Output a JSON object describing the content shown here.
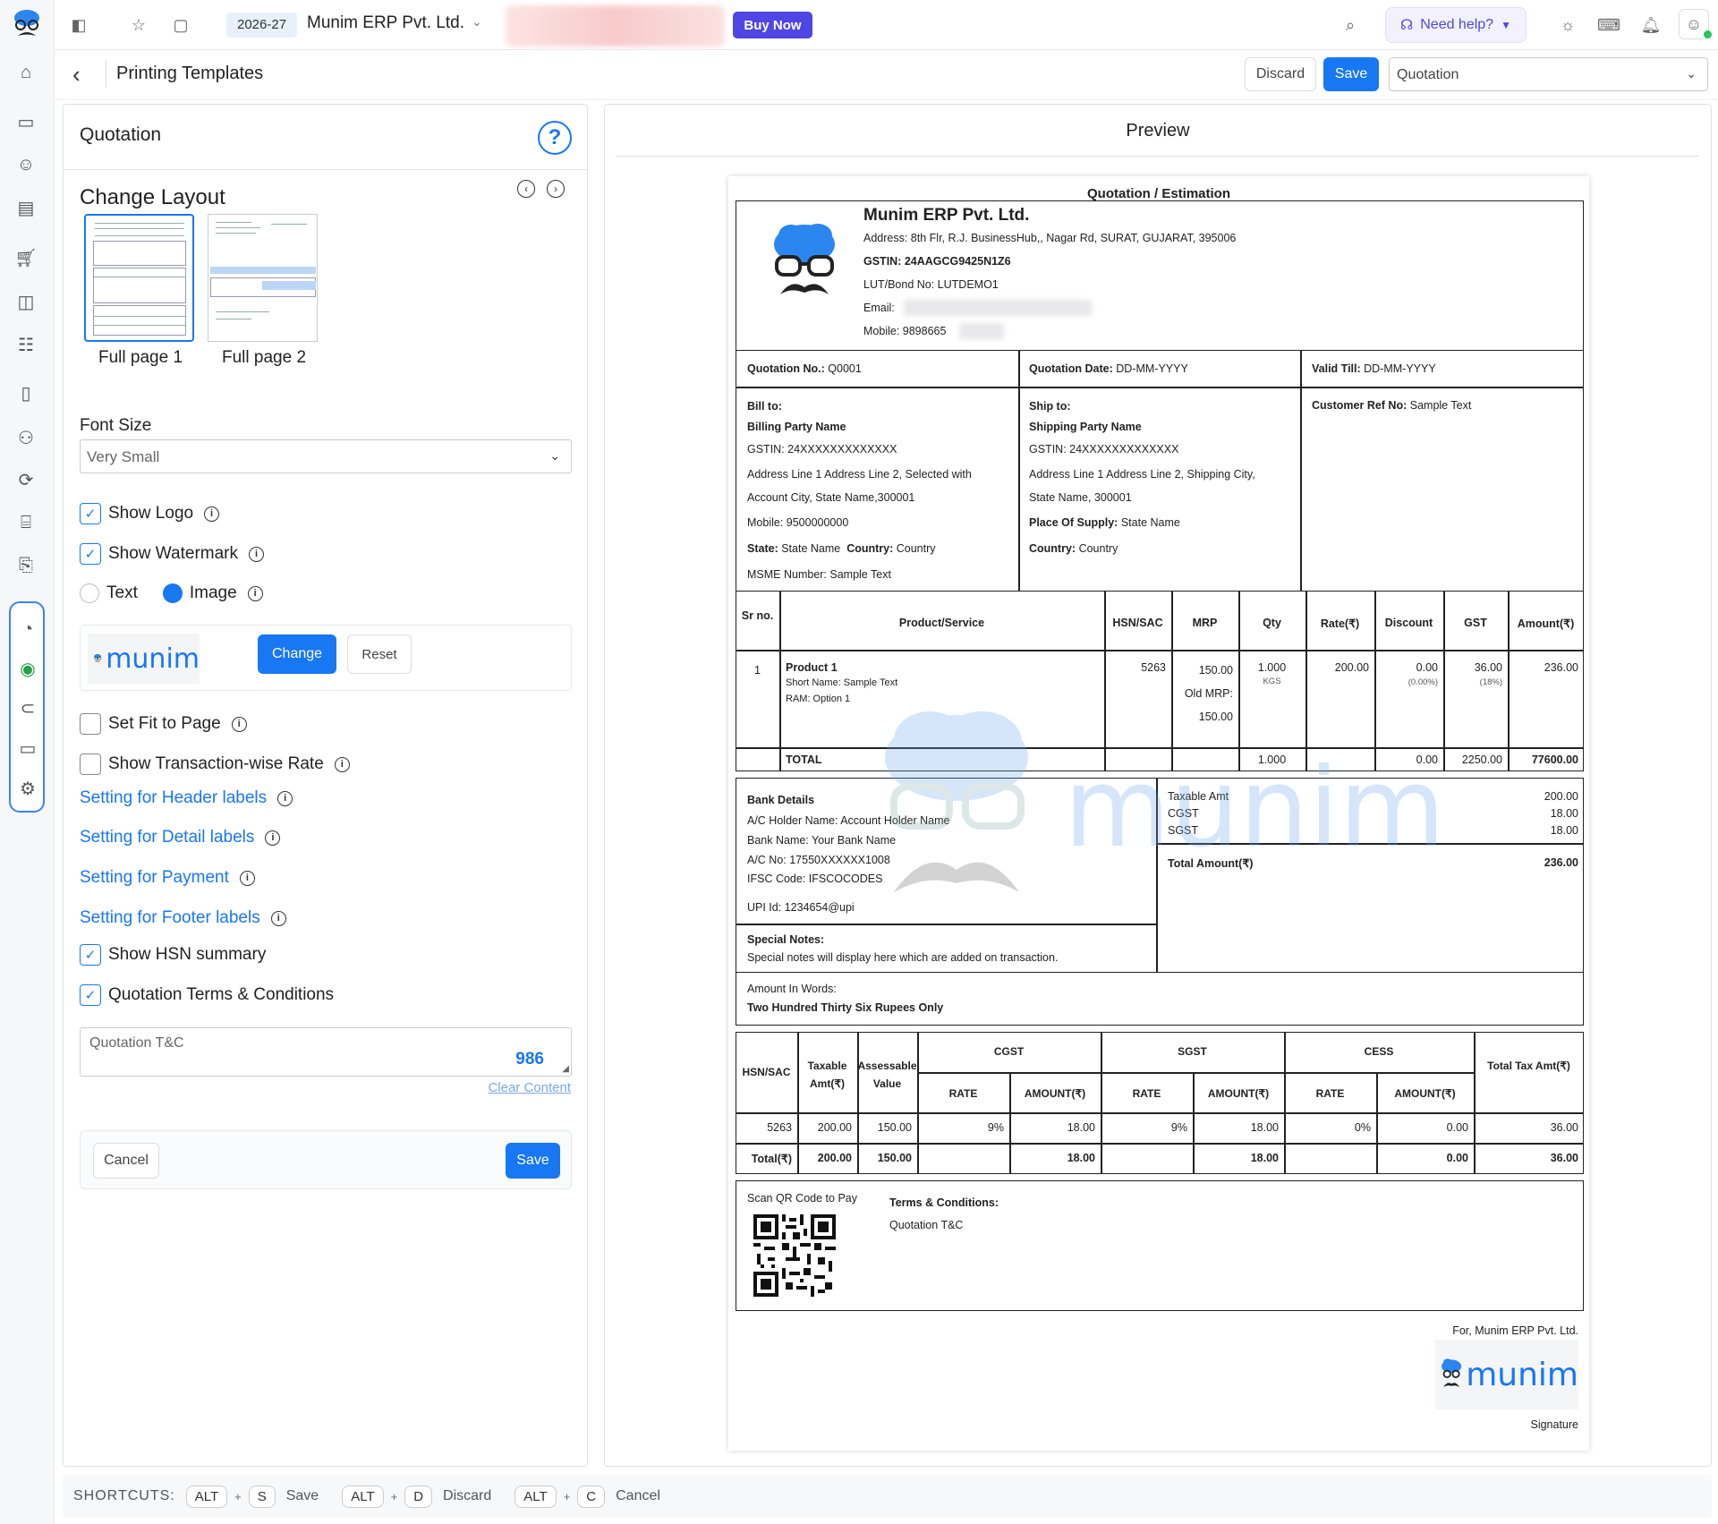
{
  "topbar": {
    "year": "2026-27",
    "company": "Munim ERP Pvt. Ltd.",
    "buy_now": "Buy Now",
    "need_help": "Need help?"
  },
  "subheader": {
    "title": "Printing Templates",
    "discard": "Discard",
    "save": "Save",
    "template_select": "Quotation"
  },
  "left": {
    "title": "Quotation",
    "help": "?",
    "change_layout": "Change Layout",
    "layouts": [
      "Full page 1",
      "Full page 2"
    ],
    "font_size_label": "Font Size",
    "font_size_value": "Very Small",
    "show_logo": "Show Logo",
    "show_watermark": "Show Watermark",
    "radio_text": "Text",
    "radio_image": "Image",
    "watermark_logo_text": "munim",
    "change": "Change",
    "reset": "Reset",
    "set_fit": "Set Fit to Page",
    "show_txn_rate": "Show Transaction-wise Rate",
    "links": [
      "Setting for Header labels",
      "Setting for Detail labels",
      "Setting for Payment",
      "Setting for Footer labels"
    ],
    "show_hsn": "Show HSN summary",
    "quotation_tc": "Quotation Terms & Conditions",
    "tc_placeholder": "Quotation  T&C",
    "tc_count": "986",
    "clear_content": "Clear Content",
    "cancel": "Cancel",
    "save": "Save"
  },
  "preview": {
    "title": "Preview",
    "doc_title": "Quotation / Estimation",
    "company": "Munim ERP Pvt. Ltd.",
    "address": "Address: 8th Flr, R.J. BusinessHub,, Nagar Rd, SURAT, GUJARAT, 395006",
    "gstin": "GSTIN: 24AAGCG9425N1Z6",
    "lut": "LUT/Bond No: LUTDEMO1",
    "email": "Email:",
    "mobile": "Mobile: 9898665",
    "quotation_no_label": "Quotation No.:",
    "quotation_no": "Q0001",
    "quotation_date_label": "Quotation Date:",
    "quotation_date": "DD-MM-YYYY",
    "valid_till_label": "Valid Till:",
    "valid_till": "DD-MM-YYYY",
    "bill_to": {
      "heading": "Bill to:",
      "name": "Billing Party Name",
      "gstin": "GSTIN: 24XXXXXXXXXXXXX",
      "addr1": "Address Line 1 Address Line 2, Selected with",
      "addr2": "Account City, State Name,300001",
      "mobile": "Mobile: 9500000000",
      "state_label": "State:",
      "state": "State Name",
      "country_label": "Country:",
      "country": "Country",
      "msme": "MSME Number: Sample Text"
    },
    "ship_to": {
      "heading": "Ship to:",
      "name": "Shipping Party Name",
      "gstin": "GSTIN: 24XXXXXXXXXXXXX",
      "addr1": "Address Line 1 Address Line 2, Shipping City,",
      "addr2": "State Name, 300001",
      "pos_label": "Place Of Supply:",
      "pos": "State Name",
      "country_label": "Country:",
      "country": "Country"
    },
    "cust_ref_label": "Customer Ref No:",
    "cust_ref": "Sample Text",
    "items_headers": [
      "Sr no.",
      "Product/Service",
      "HSN/SAC",
      "MRP",
      "Qty",
      "Rate(₹)",
      "Discount",
      "GST",
      "Amount(₹)"
    ],
    "item": {
      "sr": "1",
      "name": "Product 1",
      "short": "Short Name: Sample Text",
      "ram": "RAM: Option 1",
      "hsn": "5263",
      "mrp": "150.00",
      "old_mrp_label": "Old MRP:",
      "old_mrp": "150.00",
      "qty": "1.000",
      "unit": "KGS",
      "rate": "200.00",
      "discount": "0.00",
      "discount_pct": "(0.00%)",
      "gst": "36.00",
      "gst_pct": "(18%)",
      "amount": "236.00"
    },
    "total": {
      "label": "TOTAL",
      "qty": "1.000",
      "discount": "0.00",
      "gst": "2250.00",
      "amount": "77600.00"
    },
    "bank": {
      "heading": "Bank Details",
      "holder": "A/C Holder Name: Account Holder Name",
      "bank": "Bank Name: Your Bank Name",
      "acno": "A/C No: 17550XXXXXX1008",
      "ifsc": "IFSC Code: IFSCOCODES",
      "upi": "UPI Id: 1234654@upi"
    },
    "summary": {
      "taxable_label": "Taxable Amt",
      "taxable": "200.00",
      "cgst_label": "CGST",
      "cgst": "18.00",
      "sgst_label": "SGST",
      "sgst": "18.00",
      "total_label": "Total Amount(₹)",
      "total": "236.00"
    },
    "special_notes_label": "Special Notes:",
    "special_notes": "Special notes will display here which are added on transaction.",
    "amount_words_label": "Amount In Words:",
    "amount_words": "Two Hundred Thirty Six Rupees Only",
    "hsn_table": {
      "hsn_sac": "HSN/SAC",
      "taxable": "Taxable Amt(₹)",
      "assessable": "Assessable Value",
      "cgst": "CGST",
      "sgst": "SGST",
      "cess": "CESS",
      "rate": "RATE",
      "amount": "AMOUNT(₹)",
      "total_tax": "Total Tax Amt(₹)",
      "row": {
        "hsn": "5263",
        "taxable": "200.00",
        "assessable": "150.00",
        "cgst_rate": "9%",
        "cgst_amt": "18.00",
        "sgst_rate": "9%",
        "sgst_amt": "18.00",
        "cess_rate": "0%",
        "cess_amt": "0.00",
        "total": "36.00"
      },
      "total_row": {
        "label": "Total(₹)",
        "taxable": "200.00",
        "assessable": "150.00",
        "cgst_amt": "18.00",
        "sgst_amt": "18.00",
        "cess_amt": "0.00",
        "total": "36.00"
      }
    },
    "qr_label": "Scan QR Code to Pay",
    "terms_label": "Terms & Conditions:",
    "terms": "Quotation T&C",
    "for_company": "For, Munim ERP Pvt. Ltd.",
    "signature": "Signature",
    "sign_logo_text": "munim",
    "watermark_text": "munim"
  },
  "shortcuts": {
    "label": "SHORTCUTS:",
    "items": [
      {
        "k1": "ALT",
        "k2": "S",
        "action": "Save"
      },
      {
        "k1": "ALT",
        "k2": "D",
        "action": "Discard"
      },
      {
        "k1": "ALT",
        "k2": "C",
        "action": "Cancel"
      }
    ]
  },
  "colors": {
    "primary": "#1877f2",
    "buy_now": "#4f46e5"
  }
}
